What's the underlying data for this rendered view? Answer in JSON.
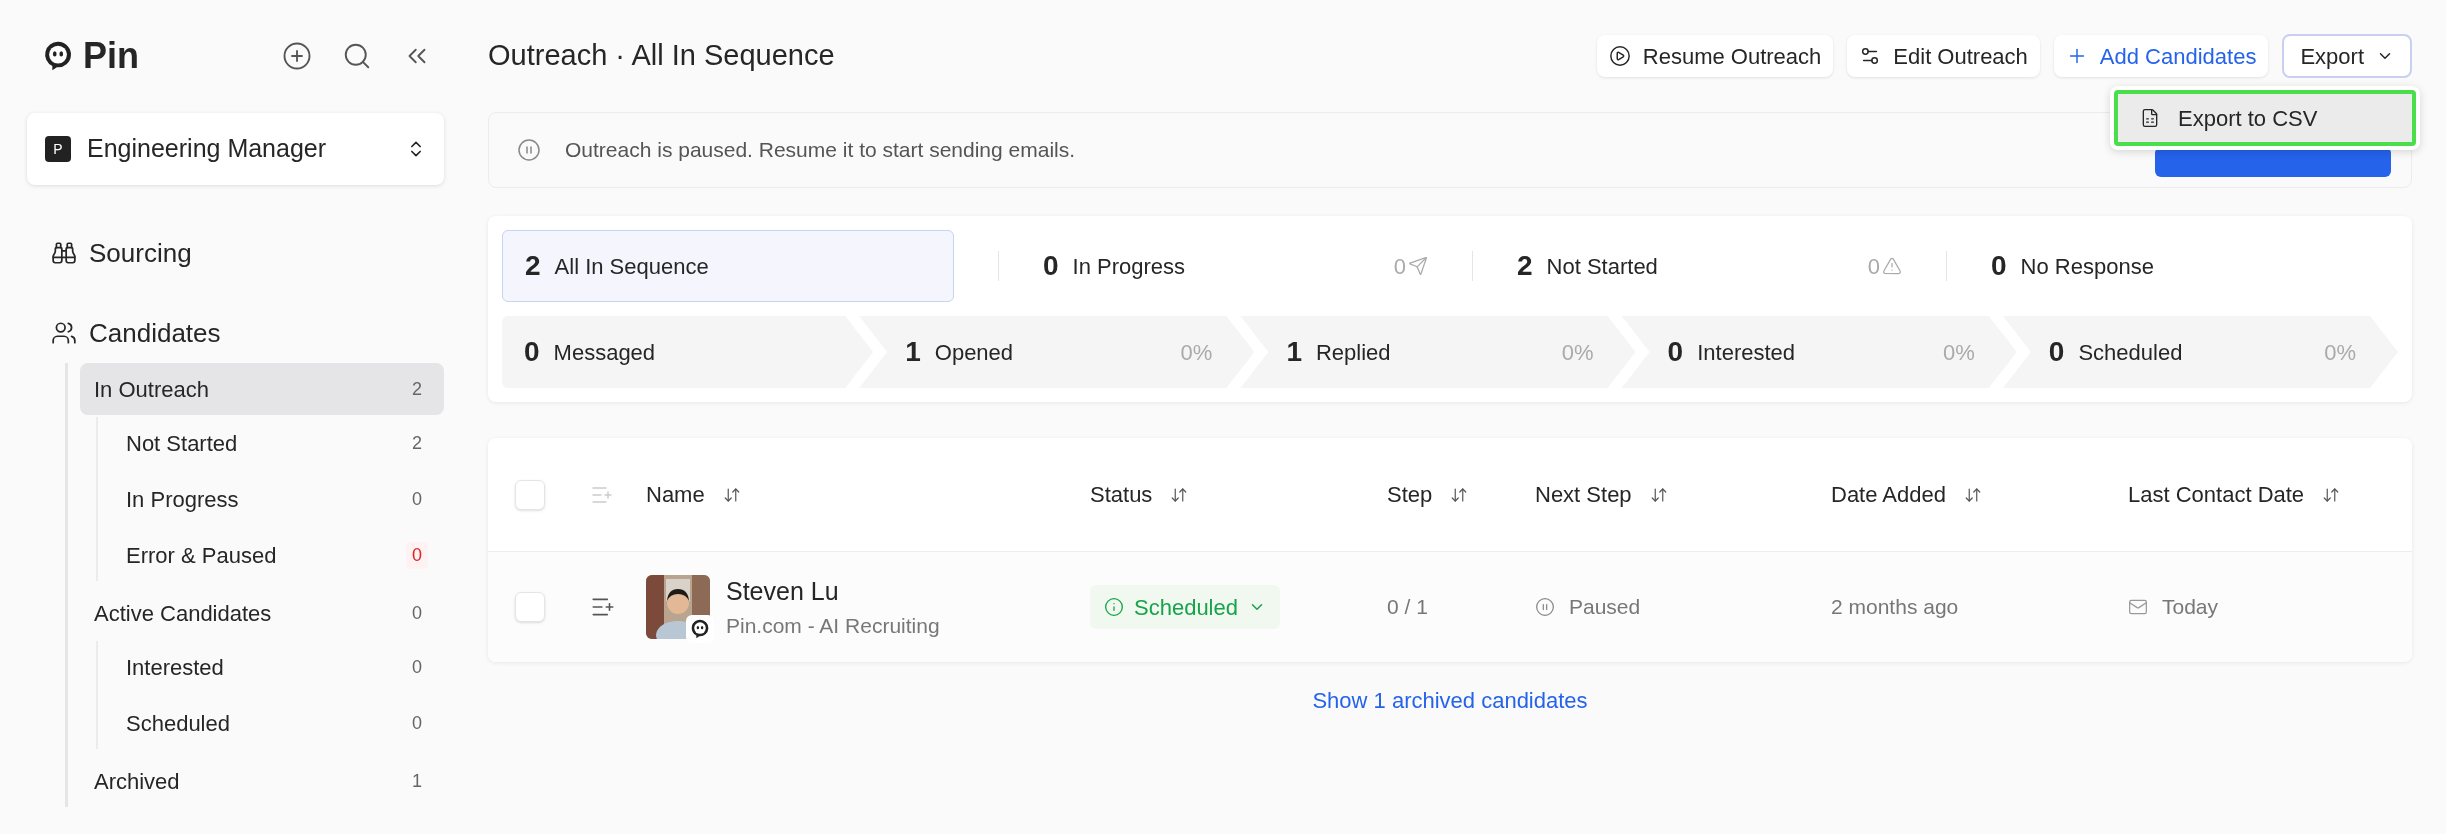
{
  "brand": {
    "name": "Pin"
  },
  "job": {
    "badge": "P",
    "title": "Engineering Manager"
  },
  "nav": [
    {
      "label": "Sourcing",
      "kind": "binoculars"
    },
    {
      "label": "Candidates",
      "kind": "people"
    }
  ],
  "sidebar_items": [
    {
      "label": "In Outreach",
      "count": "2",
      "selected": true,
      "alert": false,
      "children": [
        {
          "label": "Not Started",
          "count": "2",
          "selected": false,
          "alert": false
        },
        {
          "label": "In Progress",
          "count": "0",
          "selected": false,
          "alert": false
        },
        {
          "label": "Error & Paused",
          "count": "0",
          "selected": false,
          "alert": true
        }
      ]
    },
    {
      "label": "Active Candidates",
      "count": "0",
      "selected": false,
      "alert": false,
      "children": [
        {
          "label": "Interested",
          "count": "0",
          "selected": false,
          "alert": false
        },
        {
          "label": "Scheduled",
          "count": "0",
          "selected": false,
          "alert": false
        }
      ]
    },
    {
      "label": "Archived",
      "count": "1",
      "selected": false,
      "alert": false
    }
  ],
  "header": {
    "title": "Outreach · All In Sequence",
    "buttons": [
      {
        "label": "Resume Outreach",
        "kind": "play"
      },
      {
        "label": "Edit Outreach",
        "kind": "sliders"
      },
      {
        "label": "Add Candidates",
        "kind": "add"
      },
      {
        "label": "Export",
        "kind": "dropdown",
        "expanded": true
      }
    ]
  },
  "export_menu": [
    {
      "label": "Export to CSV",
      "selected": true
    }
  ],
  "banner": {
    "text": "Outreach is paused. Resume it to start sending emails."
  },
  "stats": {
    "top": [
      {
        "kind": "plain",
        "count": "2",
        "label": "All In Sequence",
        "selected": true
      },
      {
        "kind": "send",
        "count": "0",
        "label": "In Progress",
        "selected": false,
        "side": "0"
      },
      {
        "kind": "warning",
        "count": "2",
        "label": "Not Started",
        "selected": false,
        "side": "0"
      },
      {
        "kind": "plain",
        "count": "0",
        "label": "No Response",
        "selected": false
      }
    ],
    "funnel": [
      {
        "count": "0",
        "label": "Messaged"
      },
      {
        "count": "1",
        "label": "Opened",
        "percent": "0%"
      },
      {
        "count": "1",
        "label": "Replied",
        "percent": "0%"
      },
      {
        "count": "0",
        "label": "Interested",
        "percent": "0%"
      },
      {
        "count": "0",
        "label": "Scheduled",
        "percent": "0%"
      }
    ]
  },
  "table": {
    "header_checked": false,
    "columns": [
      "Name",
      "Status",
      "Step",
      "Next Step",
      "Date Added",
      "Last Contact Date"
    ],
    "rows": [
      {
        "checked": false,
        "name": "Steven Lu",
        "company": "Pin.com - AI Recruiting",
        "status": "Scheduled",
        "step": "0 / 1",
        "next_step": "Paused",
        "date_added": "2 months ago",
        "last_contact": "Today"
      }
    ]
  },
  "archived_link": "Show 1 archived candidates"
}
